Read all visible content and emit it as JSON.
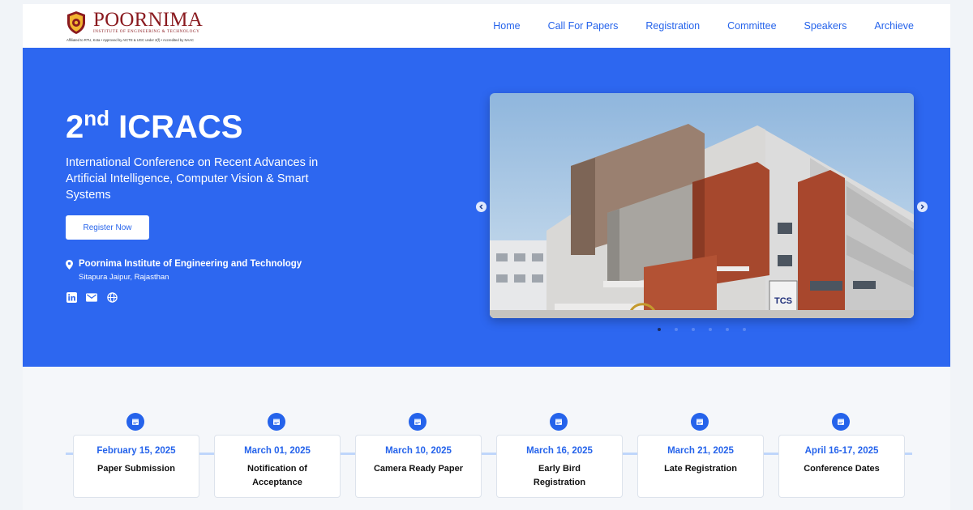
{
  "brand": {
    "name": "POORNIMA",
    "subtitle": "INSTITUTE OF ENGINEERING & TECHNOLOGY",
    "tagline": "Affiliated to RTU, Kota • Approved by AICTE & UGC under 2(f) • Accredited by NAAC"
  },
  "nav": [
    "Home",
    "Call For Papers",
    "Registration",
    "Committee",
    "Speakers",
    "Archieve"
  ],
  "hero": {
    "title": "ICRACS",
    "edition_number": "2",
    "edition_suffix": "nd",
    "subtitle": "International Conference on Recent Advances in Artificial Intelligence, Computer Vision & Smart Systems",
    "cta": "Register Now",
    "venue_name": "Poornima Institute of Engineering and Technology",
    "venue_city": "Sitapura Jaipur, Rajasthan",
    "socials": [
      "linkedin-icon",
      "mail-icon",
      "globe-icon"
    ]
  },
  "carousel": {
    "image_sign_text": "TCS",
    "slide_count": 6,
    "active_slide": 1
  },
  "timeline": [
    {
      "date": "February 15, 2025",
      "event": "Paper Submission"
    },
    {
      "date": "March 01, 2025",
      "event": "Notification of Acceptance"
    },
    {
      "date": "March 10, 2025",
      "event": "Camera Ready Paper"
    },
    {
      "date": "March 16, 2025",
      "event": "Early Bird Registration"
    },
    {
      "date": "March 21, 2025",
      "event": "Late Registration"
    },
    {
      "date": "April 16-17, 2025",
      "event": "Conference Dates"
    }
  ],
  "colors": {
    "primary": "#2563eb",
    "hero_bg": "#2d67f0",
    "brand_maroon": "#8a1a1f",
    "timeline_line": "#bfd6fb"
  }
}
